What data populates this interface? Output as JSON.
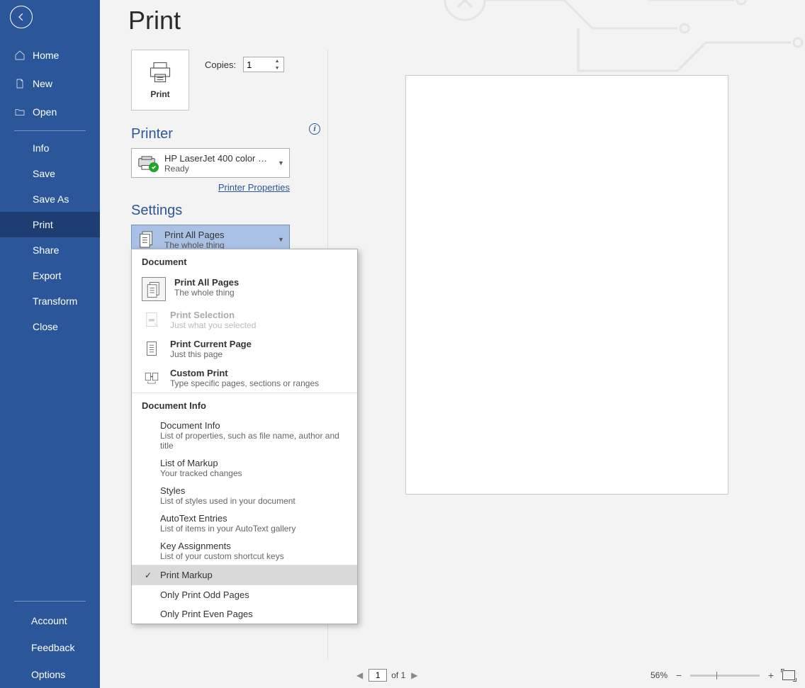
{
  "page_title": "Print",
  "sidebar": {
    "home": "Home",
    "new": "New",
    "open": "Open",
    "info": "Info",
    "save": "Save",
    "save_as": "Save As",
    "print": "Print",
    "share": "Share",
    "export": "Export",
    "transform": "Transform",
    "close": "Close",
    "account": "Account",
    "feedback": "Feedback",
    "options": "Options"
  },
  "print_button_label": "Print",
  "copies_label": "Copies:",
  "copies_value": "1",
  "printer_header": "Printer",
  "printer": {
    "name": "HP LaserJet 400 color M451...",
    "status": "Ready"
  },
  "printer_properties": "Printer Properties",
  "settings_header": "Settings",
  "settings_selected": {
    "title": "Print All Pages",
    "desc": "The whole thing"
  },
  "popup": {
    "section_document": "Document",
    "section_document_info": "Document Info",
    "print_all_pages": {
      "t": "Print All Pages",
      "d": "The whole thing"
    },
    "print_selection": {
      "t": "Print Selection",
      "d": "Just what you selected"
    },
    "print_current_page": {
      "t": "Print Current Page",
      "d": "Just this page"
    },
    "custom_print": {
      "t": "Custom Print",
      "d": "Type specific pages, sections or ranges"
    },
    "doc_info": {
      "t": "Document Info",
      "d": "List of properties, such as file name, author and title"
    },
    "list_markup": {
      "t": "List of Markup",
      "d": "Your tracked changes"
    },
    "styles": {
      "t": "Styles",
      "d": "List of styles used in your document"
    },
    "autotext": {
      "t": "AutoText Entries",
      "d": "List of items in your AutoText gallery"
    },
    "key_assign": {
      "t": "Key Assignments",
      "d": "List of your custom shortcut keys"
    },
    "print_markup": "Print Markup",
    "odd_pages": "Only Print Odd Pages",
    "even_pages": "Only Print Even Pages"
  },
  "status": {
    "page_value": "1",
    "page_of": "of 1",
    "zoom_value": "56%"
  }
}
